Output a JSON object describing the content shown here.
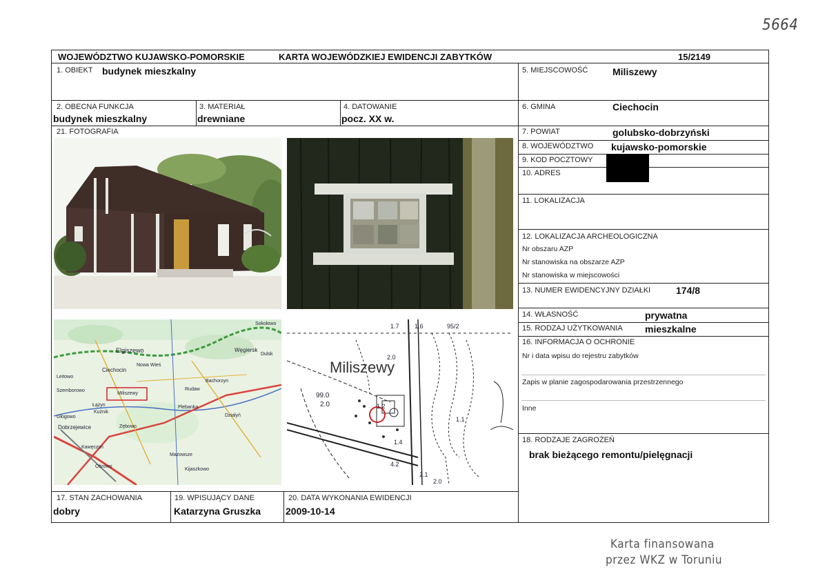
{
  "archive_number": "5664",
  "header": {
    "region": "WOJEWÓDZTWO KUJAWSKO-POMORSKIE",
    "title": "KARTA WOJEWÓDZKIEJ EWIDENCJI ZABYTKÓW",
    "card_number": "15/2149"
  },
  "fields": {
    "f1": {
      "label": "1. OBIEKT",
      "value": "budynek mieszkalny"
    },
    "f2": {
      "label": "2. OBECNA FUNKCJA",
      "value": "budynek mieszkalny"
    },
    "f3": {
      "label": "3. MATERIAŁ",
      "value": "drewniane"
    },
    "f4": {
      "label": "4. DATOWANIE",
      "value": "pocz. XX w."
    },
    "f5": {
      "label": "5. MIEJSCOWOŚĆ",
      "value": "Miliszewy"
    },
    "f6": {
      "label": "6. GMINA",
      "value": "Ciechocin"
    },
    "f7": {
      "label": "7. POWIAT",
      "value": "golubsko-dobrzyński"
    },
    "f8": {
      "label": "8. WOJEWÓDZTWO",
      "value": "kujawsko-pomorskie"
    },
    "f9": {
      "label": "9. KOD POCZTOWY"
    },
    "f10": {
      "label": "10. ADRES"
    },
    "f11": {
      "label": "11. LOKALIZACJA"
    },
    "f12": {
      "label": "12. LOKALIZACJA ARCHEOLOGICZNA",
      "lines": [
        "Nr obszaru AZP",
        "Nr stanowiska na obszarze AZP",
        "Nr stanowiska w miejscowości"
      ]
    },
    "f13": {
      "label": "13. NUMER EWIDENCYJNY DZIAŁKI",
      "value": "174/8"
    },
    "f14": {
      "label": "14. WŁASNOŚĆ",
      "value": "prywatna"
    },
    "f15": {
      "label": "15. RODZAJ UŻYTKOWANIA",
      "value": "mieszkalne"
    },
    "f16": {
      "label": "16. INFORMACJA O OCHRONIE",
      "lines": [
        "Nr i data wpisu do rejestru zabytków",
        "Zapis w planie zagospodarowania przestrzennego",
        "Inne"
      ]
    },
    "f17": {
      "label": "17. STAN ZACHOWANIA",
      "value": "dobry"
    },
    "f18": {
      "label": "18. RODZAJE ZAGROŻEŃ",
      "value": "brak bieżącego remontu/pielęgnacji"
    },
    "f19": {
      "label": "19. WPISUJĄCY DANE",
      "value": "Katarzyna Gruszka"
    },
    "f20": {
      "label": "20. DATA WYKONANIA EWIDENCJI",
      "value": "2009-10-14"
    },
    "f21": {
      "label": "21. FOTOGRAFIA"
    }
  },
  "map_road": {
    "labels": [
      "Elgiszewo",
      "Ciechocin",
      "Nowa Wieś",
      "Miliszewy",
      "Węgiersk",
      "Dulsk",
      "Łążyn",
      "Kuźnik",
      "Zębowo",
      "Dobrzejewice",
      "Kawęczyn",
      "Obrowo",
      "Plebanka",
      "Dzialyń",
      "Mazowsze",
      "Rudaw",
      "Głogowo",
      "Leitowo",
      "Szemborowo",
      "Bachorzyn",
      "Kijaszkowo",
      "Sokołowo"
    ]
  },
  "map_cadastral": {
    "village": "Miliszewy",
    "numbers": [
      "1.7",
      "1.6",
      "95/2",
      "2.0",
      "99.0",
      "2.0",
      "1.2",
      "1.1",
      "1.4",
      "4.2",
      "2.1",
      "2.0"
    ]
  },
  "footer_stamp": {
    "line1": "Karta finansowana",
    "line2": "przez WKZ w Toruniu"
  }
}
